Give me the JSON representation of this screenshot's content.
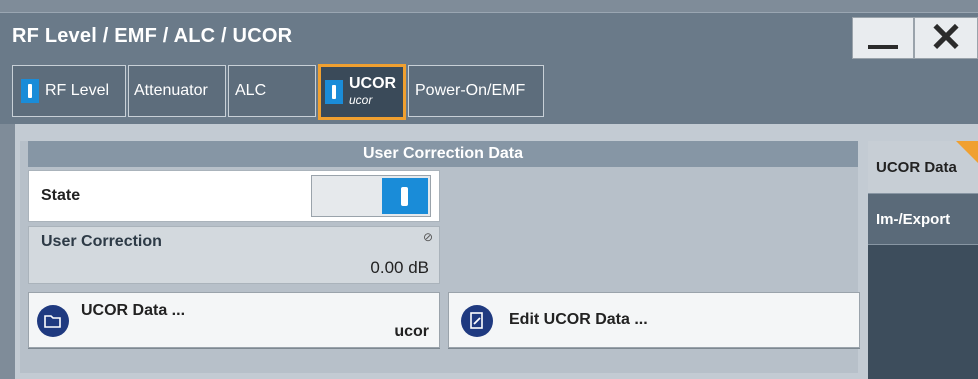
{
  "window": {
    "title": "RF Level / EMF / ALC / UCOR",
    "minimize_icon": "minimize-icon",
    "close_icon": "close-icon"
  },
  "tabs": [
    {
      "label": "RF Level",
      "indicator": "on"
    },
    {
      "label": "Attenuator"
    },
    {
      "label": "ALC"
    },
    {
      "label": "UCOR",
      "sublabel": "ucor",
      "indicator": "on",
      "active": true
    },
    {
      "label": "Power-On/EMF"
    }
  ],
  "section": {
    "header": "User Correction Data"
  },
  "state": {
    "label": "State",
    "value": "on"
  },
  "user_correction": {
    "label": "User Correction",
    "value": "0.00 dB",
    "icon": "readonly-icon"
  },
  "buttons": {
    "ucor_data": {
      "label": "UCOR Data ...",
      "value": "ucor",
      "icon": "folder-open-icon"
    },
    "edit_ucor": {
      "label": "Edit UCOR Data ...",
      "icon": "edit-document-icon"
    }
  },
  "side_tabs": [
    {
      "label": "UCOR Data",
      "active": true
    },
    {
      "label": "Im-/Export"
    }
  ],
  "colors": {
    "accent": "#f0a030",
    "toggle_on": "#1a8cd8",
    "icon_bg": "#1f3a80"
  }
}
